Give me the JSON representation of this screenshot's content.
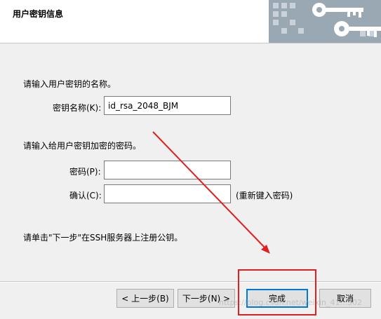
{
  "header": {
    "title": "用户密钥信息"
  },
  "prompts": {
    "name_prompt": "请输入用户密钥的名称。",
    "passphrase_prompt": "请输入给用户密钥加密的密码。",
    "next_hint": "请单击\"下一步\"在SSH服务器上注册公钥。"
  },
  "fields": {
    "key_name_label": "密钥名称(K):",
    "key_name_value": "id_rsa_2048_BJM",
    "password_label": "密码(P):",
    "password_value": "",
    "confirm_label": "确认(C):",
    "confirm_value": "",
    "confirm_hint": "(重新键入密码)"
  },
  "buttons": {
    "back": "< 上一步(B)",
    "next": "下一步(N) >",
    "finish": "完成",
    "cancel": "取消"
  },
  "watermark": "https://blog.csdn.net/weixin_41...302",
  "colors": {
    "annotation_red": "#e02020",
    "focus_blue": "#0078d7"
  }
}
